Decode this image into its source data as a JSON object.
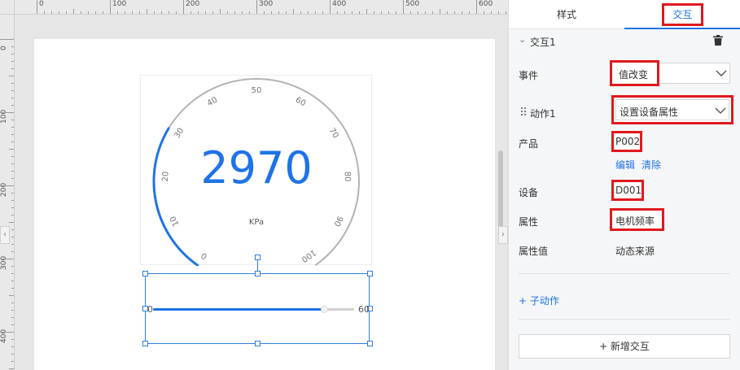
{
  "ruler": {
    "top_labels": [
      "0",
      "100",
      "200",
      "300",
      "400",
      "500",
      "600"
    ],
    "left_labels": [
      "0",
      "100",
      "200",
      "300",
      "400"
    ]
  },
  "gauge": {
    "value": "2970",
    "unit": "KPa",
    "scale_min": 0,
    "scale_max": 100,
    "tick_labels": [
      "0",
      "10",
      "20",
      "30",
      "40",
      "50",
      "60",
      "70",
      "80",
      "90",
      "100"
    ],
    "progress_fraction": 0.297,
    "colors": {
      "fill": "#1e73e8",
      "track": "#b3b3b3",
      "value_text": "#1e73e8"
    }
  },
  "slider": {
    "min_label": "0",
    "max_label": "60",
    "fill_fraction": 0.85
  },
  "panel": {
    "tabs": [
      {
        "label": "样式"
      },
      {
        "label": "交互"
      }
    ],
    "active_tab": "交互",
    "group_title": "交互1",
    "event": {
      "label": "事件",
      "value": "值改变"
    },
    "action": {
      "label": "动作1",
      "value": "设置设备属性"
    },
    "product": {
      "label": "产品",
      "value": "P002",
      "edit_label": "编辑",
      "clear_label": "清除"
    },
    "device": {
      "label": "设备",
      "value": "D001"
    },
    "attribute": {
      "label": "属性",
      "value": "电机频率"
    },
    "attribute_value": {
      "label": "属性值",
      "value": "动态来源"
    },
    "sub_action_label": "+ 子动作",
    "new_interaction_label": "+ 新增交互"
  },
  "colors": {
    "accent": "#1e73e8",
    "highlight": "#e0191d"
  },
  "icons": [
    "chevron-down-icon",
    "trash-icon",
    "drag-handle-icon",
    "collapse-left-icon",
    "collapse-right-icon"
  ]
}
